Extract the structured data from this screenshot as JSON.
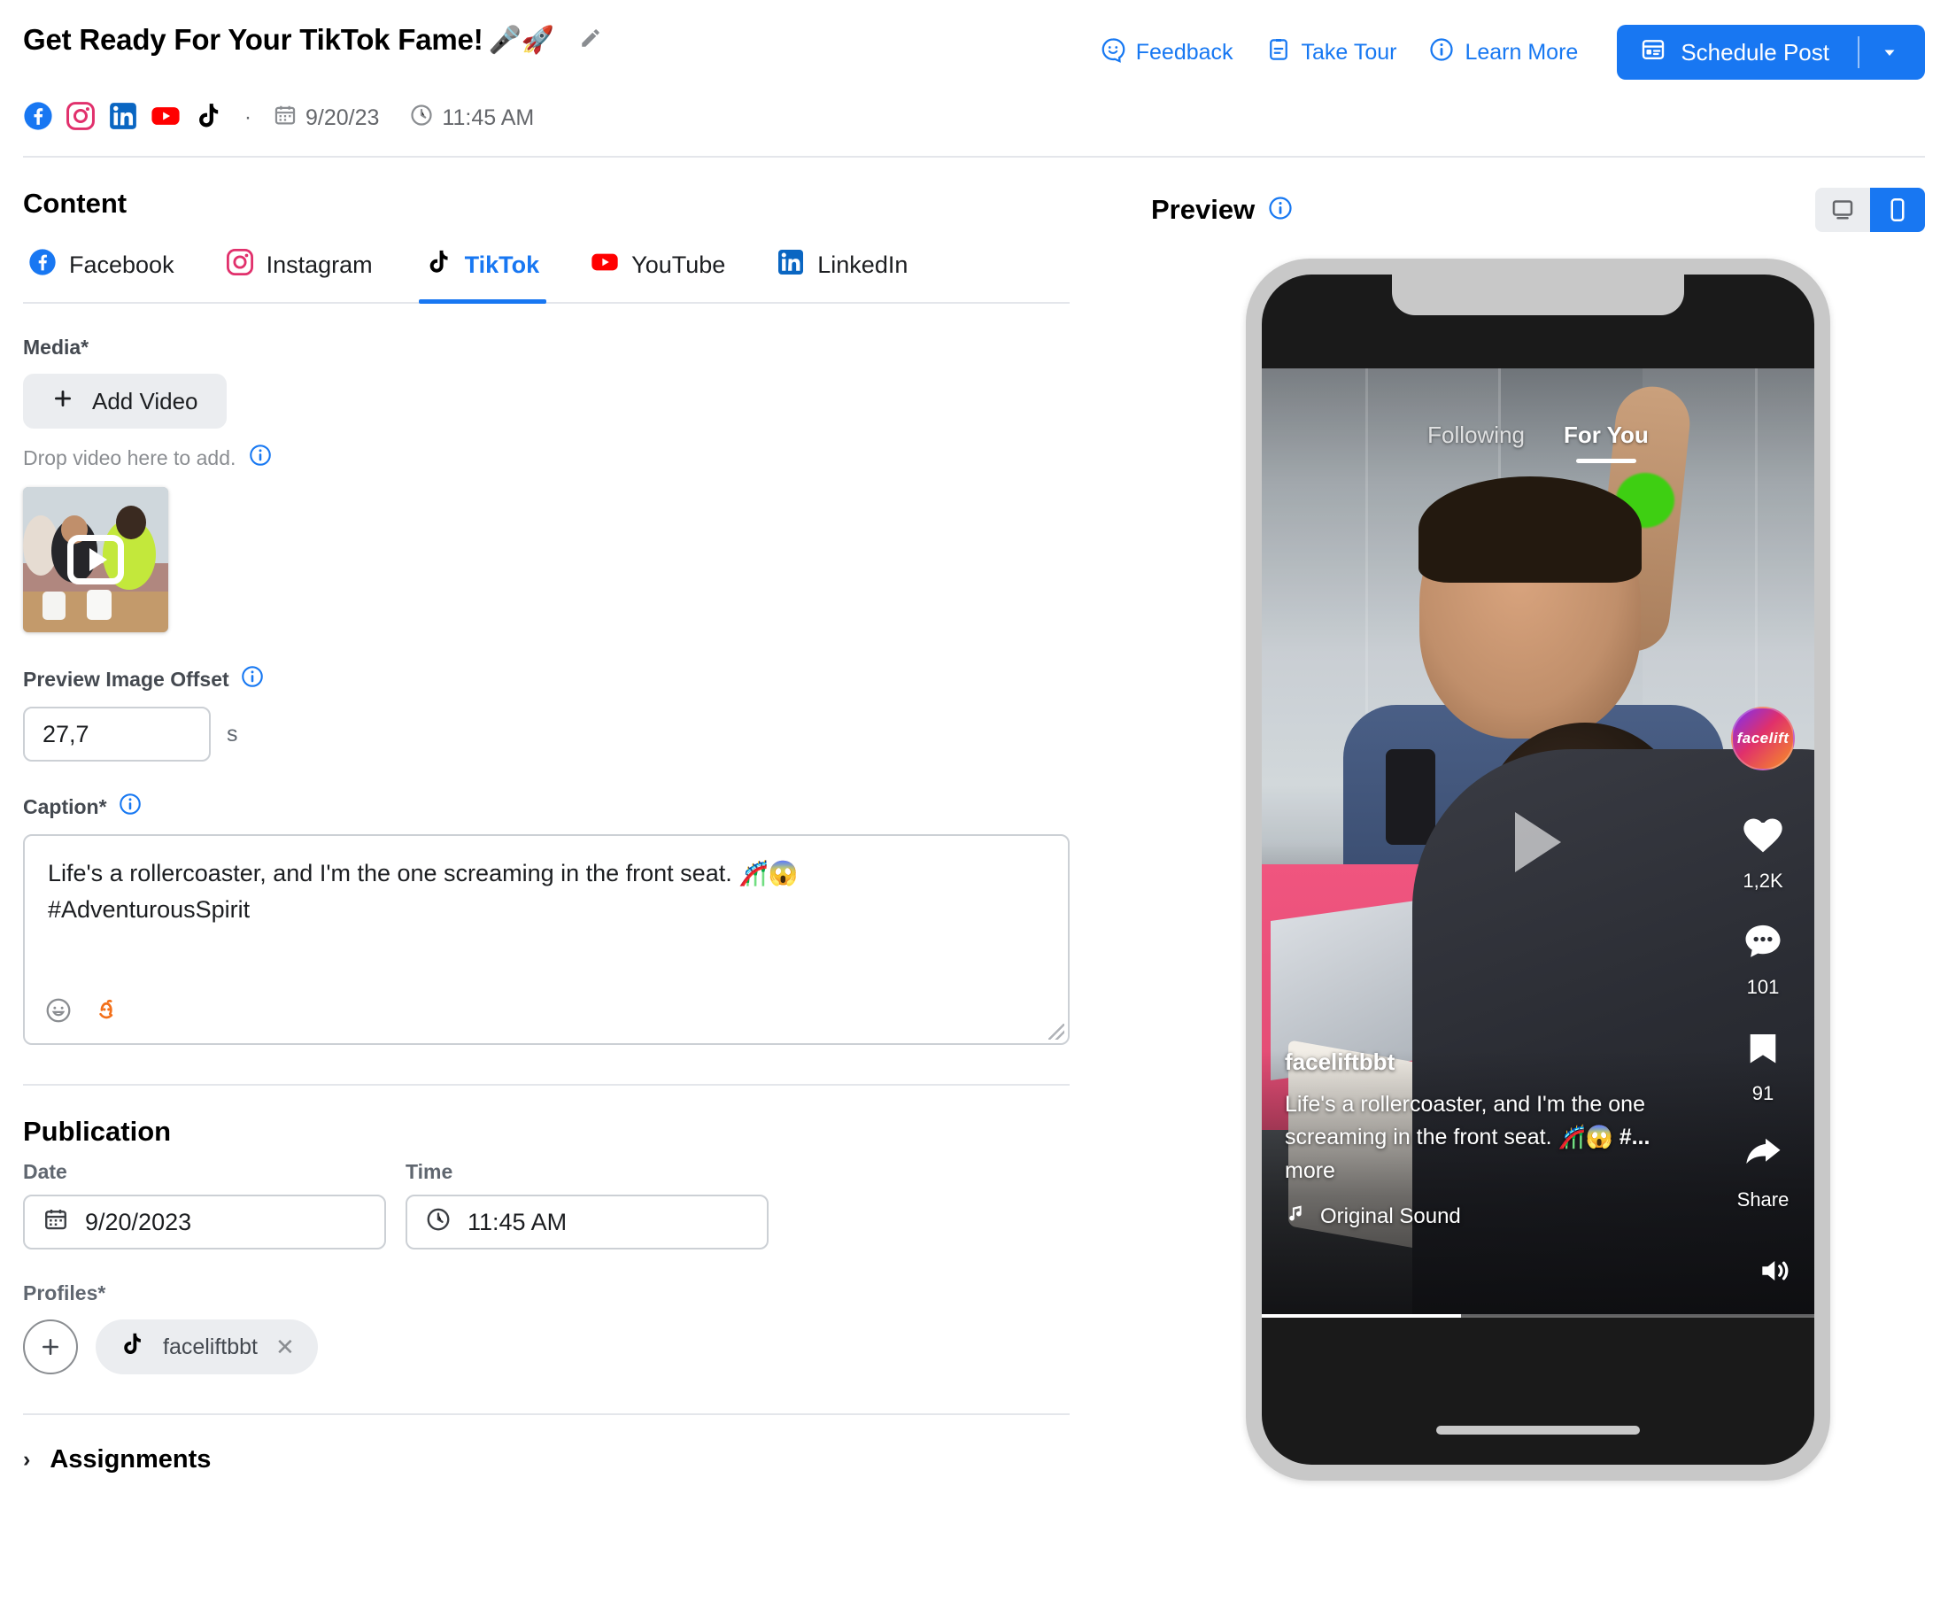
{
  "header": {
    "title": "Get Ready For Your TikTok Fame!",
    "title_emoji": "🎤🚀",
    "edit_icon": "pencil-icon",
    "links": [
      {
        "label": "Feedback",
        "icon": "feedback-smiley-icon"
      },
      {
        "label": "Take Tour",
        "icon": "tour-document-icon"
      },
      {
        "label": "Learn More",
        "icon": "info-circle-icon"
      }
    ],
    "primary_button": {
      "label": "Schedule Post",
      "icon": "calendar-post-icon",
      "caret": "▾"
    },
    "accent_color": "#1877f2",
    "link_color": "#1778f2"
  },
  "meta": {
    "networks": [
      "facebook",
      "instagram",
      "linkedin",
      "youtube",
      "tiktok"
    ],
    "separator": "·",
    "date": "9/20/23",
    "time": "11:45 AM"
  },
  "content": {
    "heading": "Content",
    "tabs": [
      {
        "label": "Facebook",
        "icon": "facebook-icon",
        "active": false
      },
      {
        "label": "Instagram",
        "icon": "instagram-icon",
        "active": false
      },
      {
        "label": "TikTok",
        "icon": "tiktok-icon",
        "active": true
      },
      {
        "label": "YouTube",
        "icon": "youtube-icon",
        "active": false
      },
      {
        "label": "LinkedIn",
        "icon": "linkedin-icon",
        "active": false
      }
    ],
    "media": {
      "label": "Media*",
      "add_button": "Add Video",
      "add_icon": "plus-icon",
      "drop_hint": "Drop video here to add.",
      "hint_icon": "info-circle-icon",
      "thumbnail_alt": "video-thumbnail"
    },
    "preview_offset": {
      "label": "Preview Image Offset",
      "info_icon": "info-circle-icon",
      "value": "27,7",
      "unit": "s"
    },
    "caption": {
      "label": "Caption*",
      "info_icon": "info-circle-icon",
      "value": "Life's a rollercoaster, and I'm the one screaming in the front seat. 🎢😱\n#AdventurousSpirit",
      "tools": [
        {
          "name": "emoji-picker-icon",
          "color": "#8a8d91"
        },
        {
          "name": "ai-assistant-icon",
          "color": "#f3701a"
        }
      ]
    }
  },
  "publication": {
    "heading": "Publication",
    "date": {
      "label": "Date",
      "value": "9/20/2023",
      "icon": "calendar-icon"
    },
    "time": {
      "label": "Time",
      "value": "11:45 AM",
      "icon": "clock-icon"
    },
    "profiles": {
      "label": "Profiles*",
      "add_icon": "plus-icon",
      "chips": [
        {
          "name": "faceliftbbt",
          "network": "tiktok",
          "remove": "✕"
        }
      ]
    }
  },
  "assignments": {
    "label": "Assignments",
    "chevron": "›",
    "expanded": false
  },
  "preview": {
    "heading": "Preview",
    "info_icon": "info-circle-icon",
    "device_toggle": [
      {
        "name": "desktop-view",
        "icon": "monitor-icon",
        "active": false
      },
      {
        "name": "mobile-view",
        "icon": "phone-icon",
        "active": true
      }
    ],
    "tiktok": {
      "tabs": [
        {
          "label": "Following",
          "active": false
        },
        {
          "label": "For You",
          "active": true
        }
      ],
      "brand_badge": "facelift",
      "actions": [
        {
          "name": "like",
          "icon": "heart-icon",
          "count": "1,2K"
        },
        {
          "name": "comment",
          "icon": "comment-icon",
          "count": "101"
        },
        {
          "name": "bookmark",
          "icon": "bookmark-icon",
          "count": "91"
        },
        {
          "name": "share",
          "icon": "share-arrow-icon",
          "count": "Share"
        }
      ],
      "username": "faceliftbbt",
      "caption": "Life's a rollercoaster, and I'm the one screaming in the front seat. 🎢😱 ",
      "caption_hashtag": "#...",
      "caption_more": " more",
      "sound": "Original Sound",
      "sound_icon": "music-note-icon",
      "speaker_icon": "speaker-on-icon",
      "play_icon": "play-triangle-icon"
    }
  }
}
